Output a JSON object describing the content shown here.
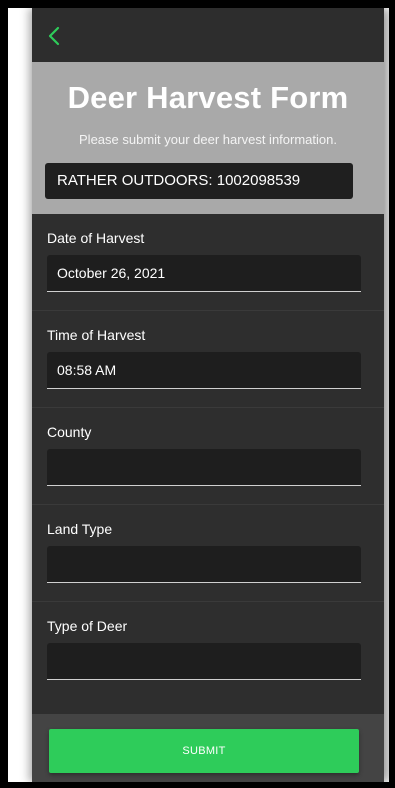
{
  "colors": {
    "accent": "#2ecc5a",
    "header_bg": "#a9a9a9",
    "form_bg": "#2e2e2e",
    "input_bg": "#1e1e1e"
  },
  "nav": {
    "back_icon": "chevron-left-icon"
  },
  "header": {
    "title": "Deer Harvest Form",
    "subtitle": "Please submit your deer harvest information.",
    "account": "RATHER OUTDOORS: 1002098539"
  },
  "form": {
    "fields": [
      {
        "label": "Date of Harvest",
        "value": "October 26, 2021"
      },
      {
        "label": "Time of Harvest",
        "value": "08:58 AM"
      },
      {
        "label": "County",
        "value": ""
      },
      {
        "label": "Land Type",
        "value": ""
      },
      {
        "label": "Type of Deer",
        "value": ""
      }
    ]
  },
  "footer": {
    "submit_label": "SUBMIT"
  }
}
